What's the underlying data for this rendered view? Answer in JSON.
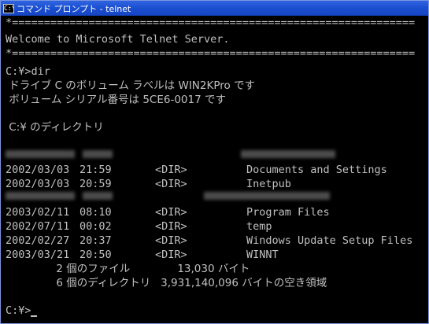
{
  "window": {
    "title": "コマンド プロンプト - telnet",
    "icon_text": "C:\\"
  },
  "console": {
    "border_top": "*===============================================================",
    "welcome": "Welcome to Microsoft Telnet Server.",
    "border_bottom": "*===============================================================",
    "command": "C:¥>dir",
    "volume_label": " ドライブ C のボリューム ラベルは WIN2KPro です",
    "serial": " ボリューム シリアル番号は 5CE6-0017 です",
    "directory_of": " C:¥ のディレクトリ",
    "entries": [
      {
        "date": "2002/03/03",
        "time": "21:59",
        "type": "<DIR>",
        "name": "Documents and Settings"
      },
      {
        "date": "2002/03/03",
        "time": "20:59",
        "type": "<DIR>",
        "name": "Inetpub"
      },
      {
        "date": "2003/02/11",
        "time": "08:10",
        "type": "<DIR>",
        "name": "Program Files"
      },
      {
        "date": "2002/07/11",
        "time": "00:02",
        "type": "<DIR>",
        "name": "temp"
      },
      {
        "date": "2002/02/27",
        "time": "20:37",
        "type": "<DIR>",
        "name": "Windows Update Setup Files"
      },
      {
        "date": "2003/03/21",
        "time": "20:50",
        "type": "<DIR>",
        "name": "WINNT"
      }
    ],
    "summary_files": "               2 個のファイル              13,030 バイト",
    "summary_dirs": "               6 個のディレクトリ   3,931,140,096 バイトの空き領域",
    "prompt": "C:¥>"
  }
}
